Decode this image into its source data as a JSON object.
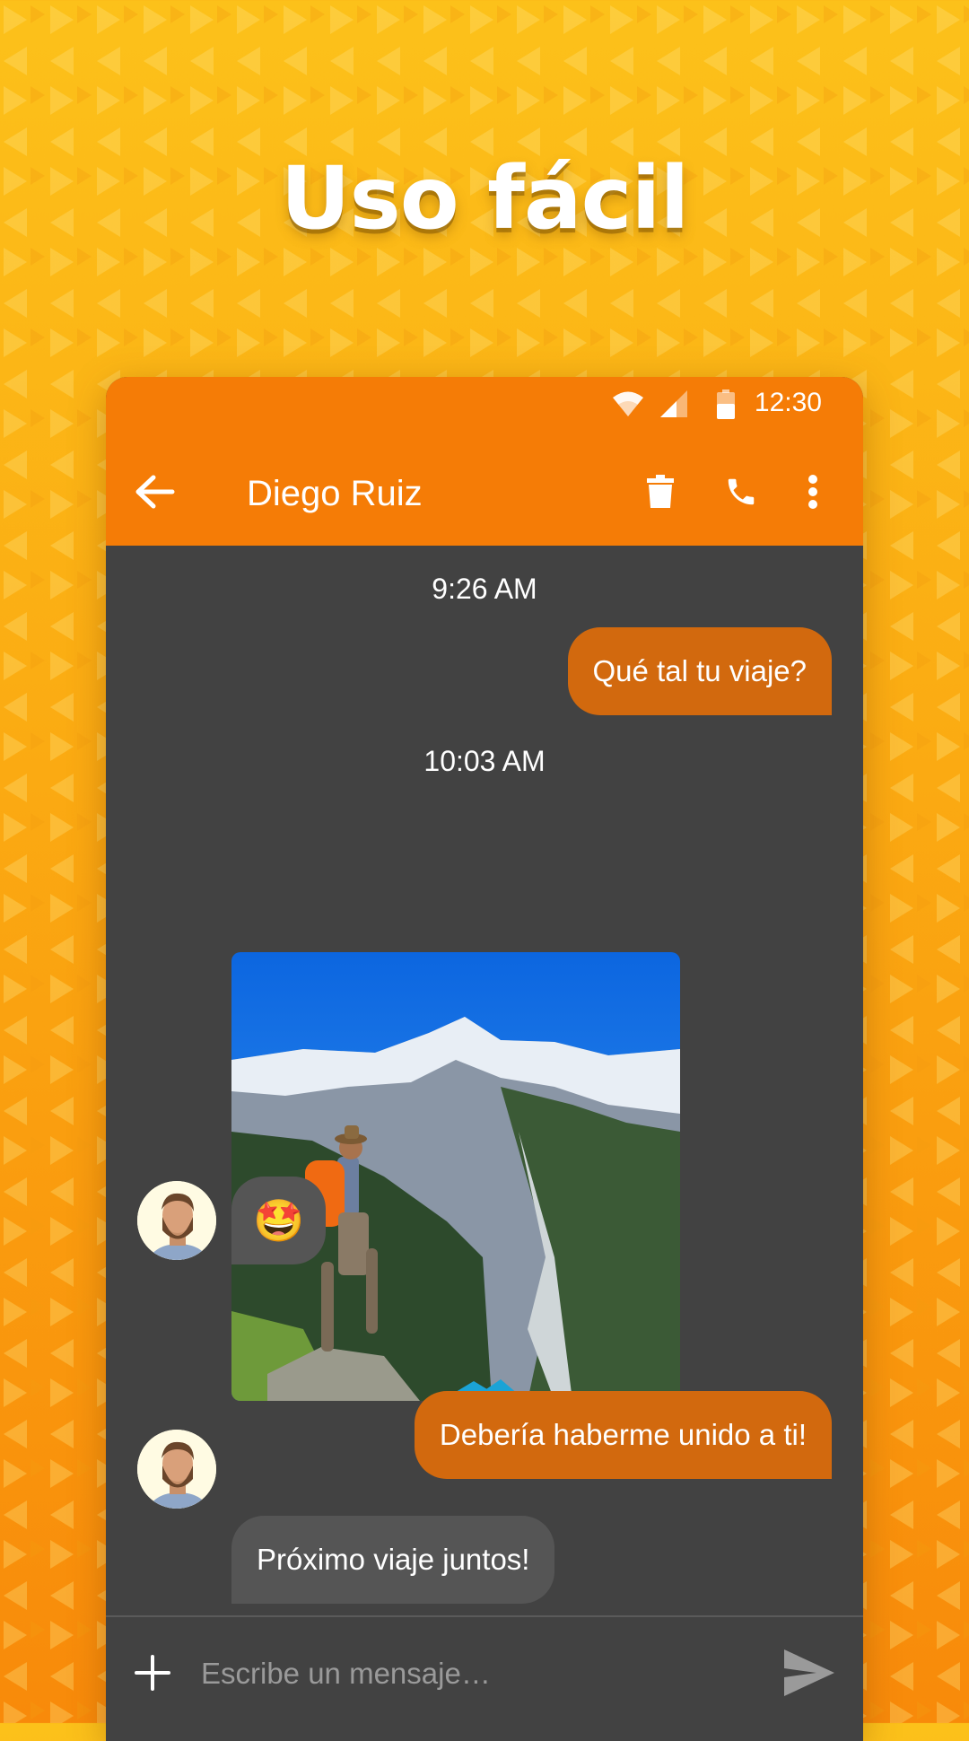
{
  "headline": "Uso fácil",
  "status_bar": {
    "time": "12:30",
    "icons": [
      "wifi-icon",
      "signal-icon",
      "battery-icon"
    ]
  },
  "app_bar": {
    "contact_name": "Diego Ruiz",
    "icons": [
      "back-arrow-icon",
      "delete-icon",
      "phone-icon",
      "more-vert-icon"
    ]
  },
  "messages": [
    {
      "type": "timestamp",
      "text": "9:26 AM"
    },
    {
      "type": "outgoing",
      "text": "Qué tal tu viaje?"
    },
    {
      "type": "timestamp",
      "text": "10:03 AM"
    },
    {
      "type": "incoming-image",
      "description": "hiker-photo"
    },
    {
      "type": "incoming",
      "text": "🤩"
    },
    {
      "type": "outgoing",
      "text": "Debería haberme unido a ti!"
    },
    {
      "type": "incoming",
      "text": "Próximo viaje juntos!"
    }
  ],
  "composer": {
    "placeholder": "Escribe un mensaje…",
    "icons": [
      "plus-icon",
      "send-icon"
    ]
  },
  "colors": {
    "accent": "#f57c06",
    "outgoing_bubble": "#d2690e",
    "incoming_bubble": "#555555",
    "chat_background": "#424242",
    "background_top": "#fcc11a",
    "background_bottom": "#f88a0a"
  }
}
